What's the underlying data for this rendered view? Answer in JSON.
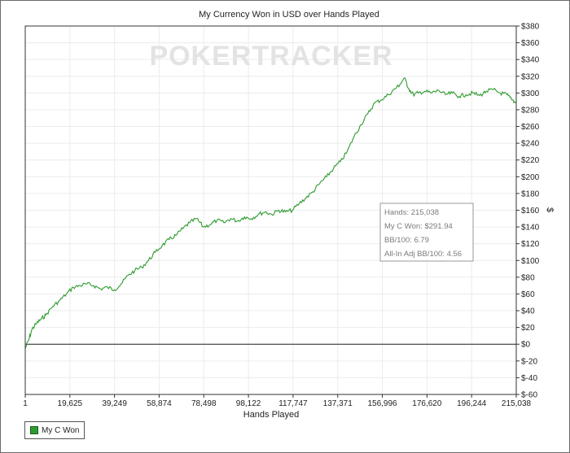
{
  "chart_data": {
    "type": "line",
    "title": "My Currency Won in USD over Hands Played",
    "xlabel": "Hands Played",
    "ylabel": "$",
    "watermark": "POKERTRACKER",
    "xlim": [
      1,
      215038
    ],
    "ylim": [
      -60,
      380
    ],
    "x_ticks": [
      "1",
      "19,625",
      "39,249",
      "58,874",
      "78,498",
      "98,122",
      "117,747",
      "137,371",
      "156,996",
      "176,620",
      "196,244",
      "215,038"
    ],
    "y_ticks": [
      "$380",
      "$360",
      "$340",
      "$320",
      "$300",
      "$280",
      "$260",
      "$240",
      "$220",
      "$200",
      "$180",
      "$160",
      "$140",
      "$120",
      "$100",
      "$80",
      "$60",
      "$40",
      "$20",
      "$0",
      "$-20",
      "$-40",
      "$-60"
    ],
    "grid": true,
    "legend_position": "bottom-left",
    "series": [
      {
        "name": "My C Won",
        "color": "#2d9b2d",
        "x": [
          1,
          1500,
          3000,
          5000,
          7000,
          9000,
          12000,
          15000,
          18000,
          21000,
          24000,
          27000,
          30000,
          33000,
          36000,
          39000,
          42000,
          45000,
          48000,
          51000,
          54000,
          57000,
          60000,
          63000,
          66000,
          69000,
          72000,
          75000,
          78000,
          81000,
          84000,
          87000,
          90000,
          93000,
          96000,
          99000,
          102000,
          105000,
          108000,
          111000,
          114000,
          117000,
          120000,
          123000,
          126000,
          129000,
          132000,
          135000,
          138000,
          141000,
          144000,
          147000,
          150000,
          153000,
          156000,
          159000,
          162000,
          164000,
          166000,
          168000,
          170000,
          172000,
          175000,
          178000,
          181000,
          184000,
          187000,
          190000,
          193000,
          196000,
          199000,
          202000,
          205000,
          208000,
          211000,
          213000,
          215038
        ],
        "y": [
          -5,
          5,
          18,
          25,
          30,
          35,
          45,
          52,
          60,
          68,
          70,
          72,
          70,
          66,
          68,
          65,
          72,
          82,
          88,
          92,
          100,
          110,
          118,
          125,
          130,
          138,
          145,
          150,
          140,
          143,
          148,
          145,
          150,
          147,
          152,
          150,
          155,
          158,
          155,
          160,
          158,
          160,
          168,
          175,
          182,
          192,
          200,
          210,
          218,
          230,
          248,
          262,
          275,
          288,
          292,
          298,
          305,
          310,
          318,
          305,
          298,
          300,
          302,
          300,
          303,
          298,
          300,
          296,
          298,
          300,
          297,
          302,
          304,
          300,
          298,
          292,
          288
        ]
      }
    ]
  },
  "info_box": {
    "hands": "Hands: 215,038",
    "won": "My C Won: $291.94",
    "bb100": "BB/100: 6.79",
    "allin": "All-In Adj BB/100: 4.56"
  },
  "legend": {
    "label": "My C Won"
  }
}
